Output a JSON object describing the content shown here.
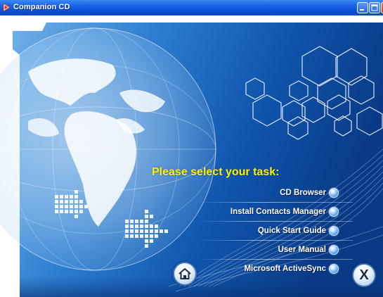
{
  "window": {
    "title": "Companion CD",
    "controls": [
      "minimize",
      "maximize",
      "close"
    ]
  },
  "main": {
    "headline": "Please select your task:",
    "menu": [
      {
        "label": "CD Browser"
      },
      {
        "label": "Install Contacts Manager"
      },
      {
        "label": "Quick Start Guide"
      },
      {
        "label": "User Manual"
      },
      {
        "label": "Microsoft ActiveSync"
      }
    ],
    "home_icon": "home-icon",
    "close_label": "X"
  },
  "colors": {
    "background_dark": "#0b3f8f",
    "background_light": "#7fb9ea",
    "headline": "#fff200",
    "menu_text": "#ffffff",
    "titlebar": "#0a4fd3"
  }
}
